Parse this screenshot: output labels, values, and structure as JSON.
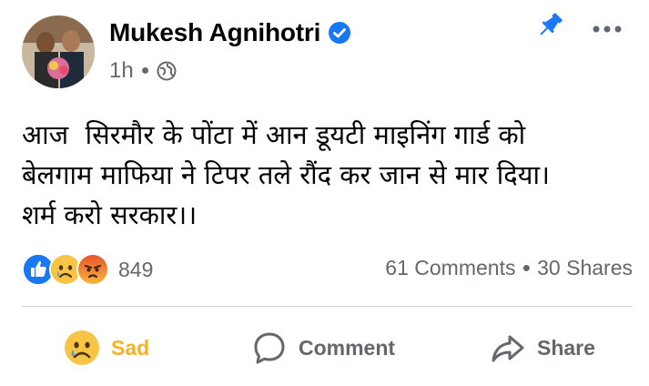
{
  "post": {
    "author": "Mukesh Agnihotri",
    "verified": true,
    "timestamp": "1h",
    "privacy_icon": "globe-icon",
    "pinned_icon": "pin-icon",
    "text": "आज  सिरमौर के पोंटा में आन डूयटी माइनिंग गार्ड को\nबेलगाम माफिया ने टिपर तले रौंद कर जान से मार दिया।\nशर्म करो सरकार।।"
  },
  "reactions": {
    "icons": [
      "like-icon",
      "sad-icon",
      "angry-icon"
    ],
    "count": "849"
  },
  "engagement": {
    "comments": "61 Comments",
    "shares": "30 Shares"
  },
  "actions": {
    "reaction_label": "Sad",
    "comment_label": "Comment",
    "share_label": "Share"
  },
  "colors": {
    "brand_blue": "#1877f2",
    "sad_yellow": "#f7b125",
    "secondary_text": "#65676b",
    "divider": "#ced0d4"
  }
}
